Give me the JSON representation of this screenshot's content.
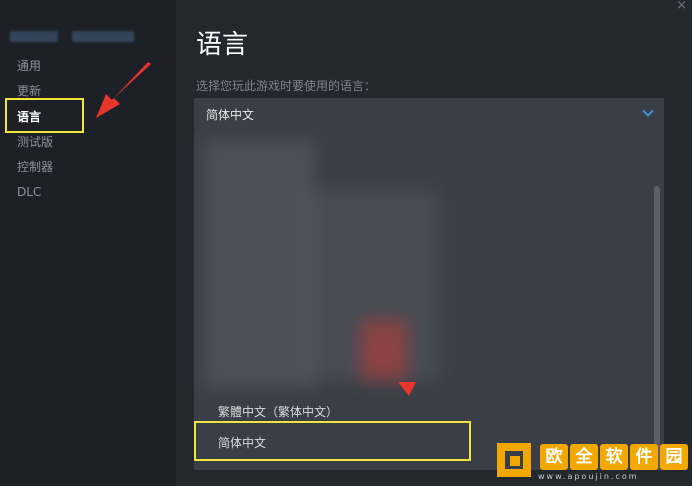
{
  "window": {
    "close_symbol": "×"
  },
  "sidebar": {
    "items": [
      {
        "label": "通用",
        "active": false
      },
      {
        "label": "更新",
        "active": false
      },
      {
        "label": "语言",
        "active": true
      },
      {
        "label": "测试版",
        "active": false
      },
      {
        "label": "控制器",
        "active": false
      },
      {
        "label": "DLC",
        "active": false
      }
    ]
  },
  "main": {
    "title": "语言",
    "field_label": "选择您玩此游戏时要使用的语言：",
    "select": {
      "value": "简体中文",
      "icon": "chevron-down-icon"
    },
    "dropdown_options": [
      {
        "label": "繁體中文（繁体中文）",
        "highlighted": false
      },
      {
        "label": "简体中文",
        "highlighted": true
      }
    ]
  },
  "watermark": {
    "chars": [
      "欧",
      "全",
      "软",
      "件",
      "园"
    ],
    "url": "www.apoujin.com"
  },
  "colors": {
    "highlight": "#f3e33a",
    "annotation_arrow": "#e8352b",
    "accent_chevron": "#3d9ae8",
    "watermark_orange": "#f2a800"
  }
}
